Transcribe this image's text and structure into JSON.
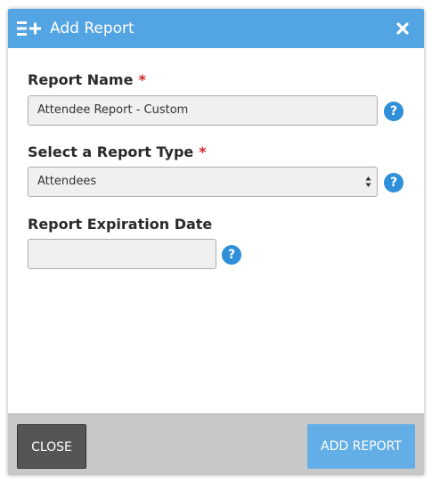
{
  "dialog": {
    "title": "Add Report",
    "title_icon": "list-add-icon",
    "close_icon": "close-icon"
  },
  "form": {
    "report_name": {
      "label": "Report Name",
      "required_mark": "*",
      "value": "Attendee Report - Custom"
    },
    "report_type": {
      "label": "Select a Report Type",
      "required_mark": "*",
      "selected": "Attendees"
    },
    "expiration": {
      "label": "Report Expiration Date",
      "value": ""
    },
    "help_glyph": "?"
  },
  "footer": {
    "close_label": "CLOSE",
    "add_label": "ADD REPORT"
  },
  "colors": {
    "header": "#53a4e2",
    "help": "#2f8fd8",
    "required": "#d2262b",
    "close_button": "#555555",
    "add_button": "#63aee6",
    "footer": "#c8c8c8"
  }
}
